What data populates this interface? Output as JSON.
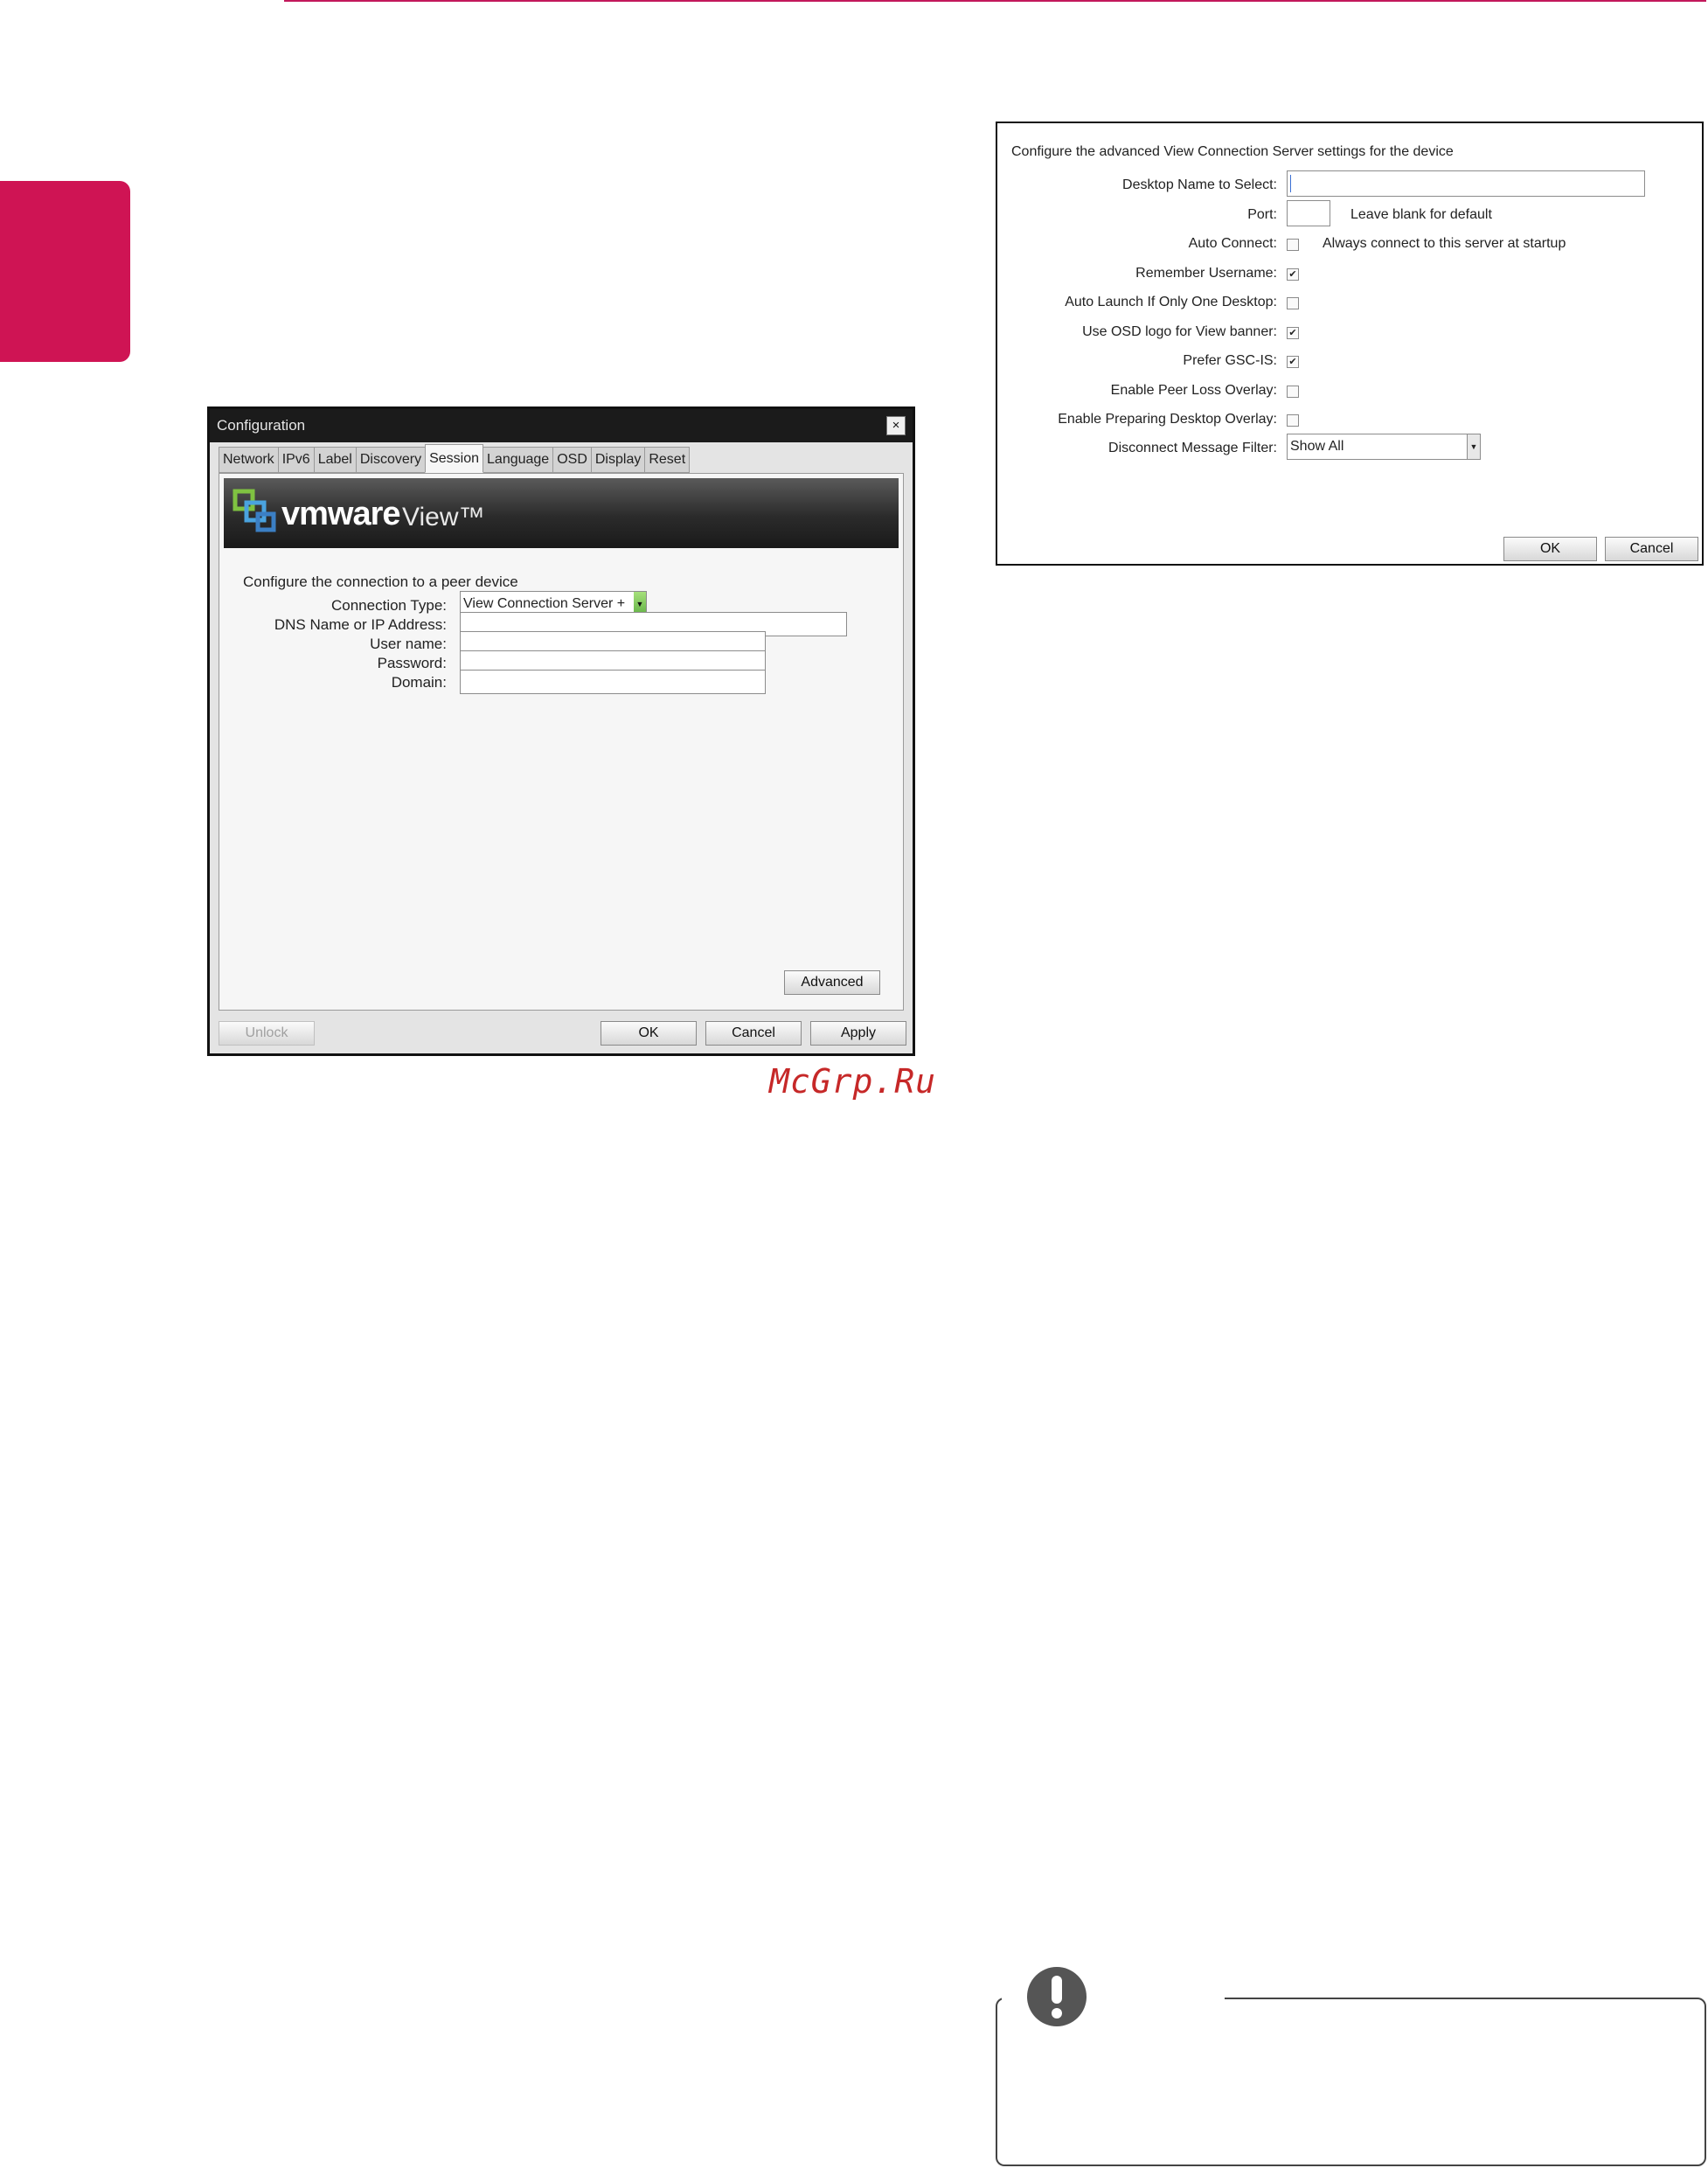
{
  "config_window": {
    "title": "Configuration",
    "close_glyph": "×",
    "tabs": [
      "Network",
      "IPv6",
      "Label",
      "Discovery",
      "Session",
      "Language",
      "OSD",
      "Display",
      "Reset"
    ],
    "active_tab": "Session",
    "brand": "vmware",
    "brand_product": "View™",
    "heading": "Configure the connection to a peer device",
    "connection_type_label": "Connection Type:",
    "connection_type_value": "View Connection Server + Auto-Logon",
    "dns_label": "DNS Name or IP Address:",
    "username_label": "User name:",
    "password_label": "Password:",
    "domain_label": "Domain:",
    "advanced_button": "Advanced",
    "unlock_button": "Unlock",
    "ok_button": "OK",
    "cancel_button": "Cancel",
    "apply_button": "Apply"
  },
  "watermark": "McGrp.Ru",
  "advanced_dialog": {
    "heading": "Configure the advanced View Connection Server settings for the device",
    "desktop_name_label": "Desktop Name to Select:",
    "port_label": "Port:",
    "port_hint": "Leave blank for default",
    "auto_connect_label": "Auto Connect:",
    "auto_connect_hint": "Always connect to this server at startup",
    "auto_connect_checked": false,
    "remember_username_label": "Remember Username:",
    "remember_username_checked": true,
    "auto_launch_label": "Auto Launch If Only One Desktop:",
    "auto_launch_checked": false,
    "osd_logo_label": "Use OSD logo for View banner:",
    "osd_logo_checked": true,
    "prefer_gsc_label": "Prefer GSC-IS:",
    "prefer_gsc_checked": true,
    "peer_loss_label": "Enable Peer Loss Overlay:",
    "peer_loss_checked": false,
    "preparing_desktop_label": "Enable Preparing Desktop Overlay:",
    "preparing_desktop_checked": false,
    "disconnect_filter_label": "Disconnect Message Filter:",
    "disconnect_filter_value": "Show All",
    "ok_button": "OK",
    "cancel_button": "Cancel"
  },
  "colors": {
    "accent": "#cf1454",
    "titlebar": "#1b1b1b"
  }
}
